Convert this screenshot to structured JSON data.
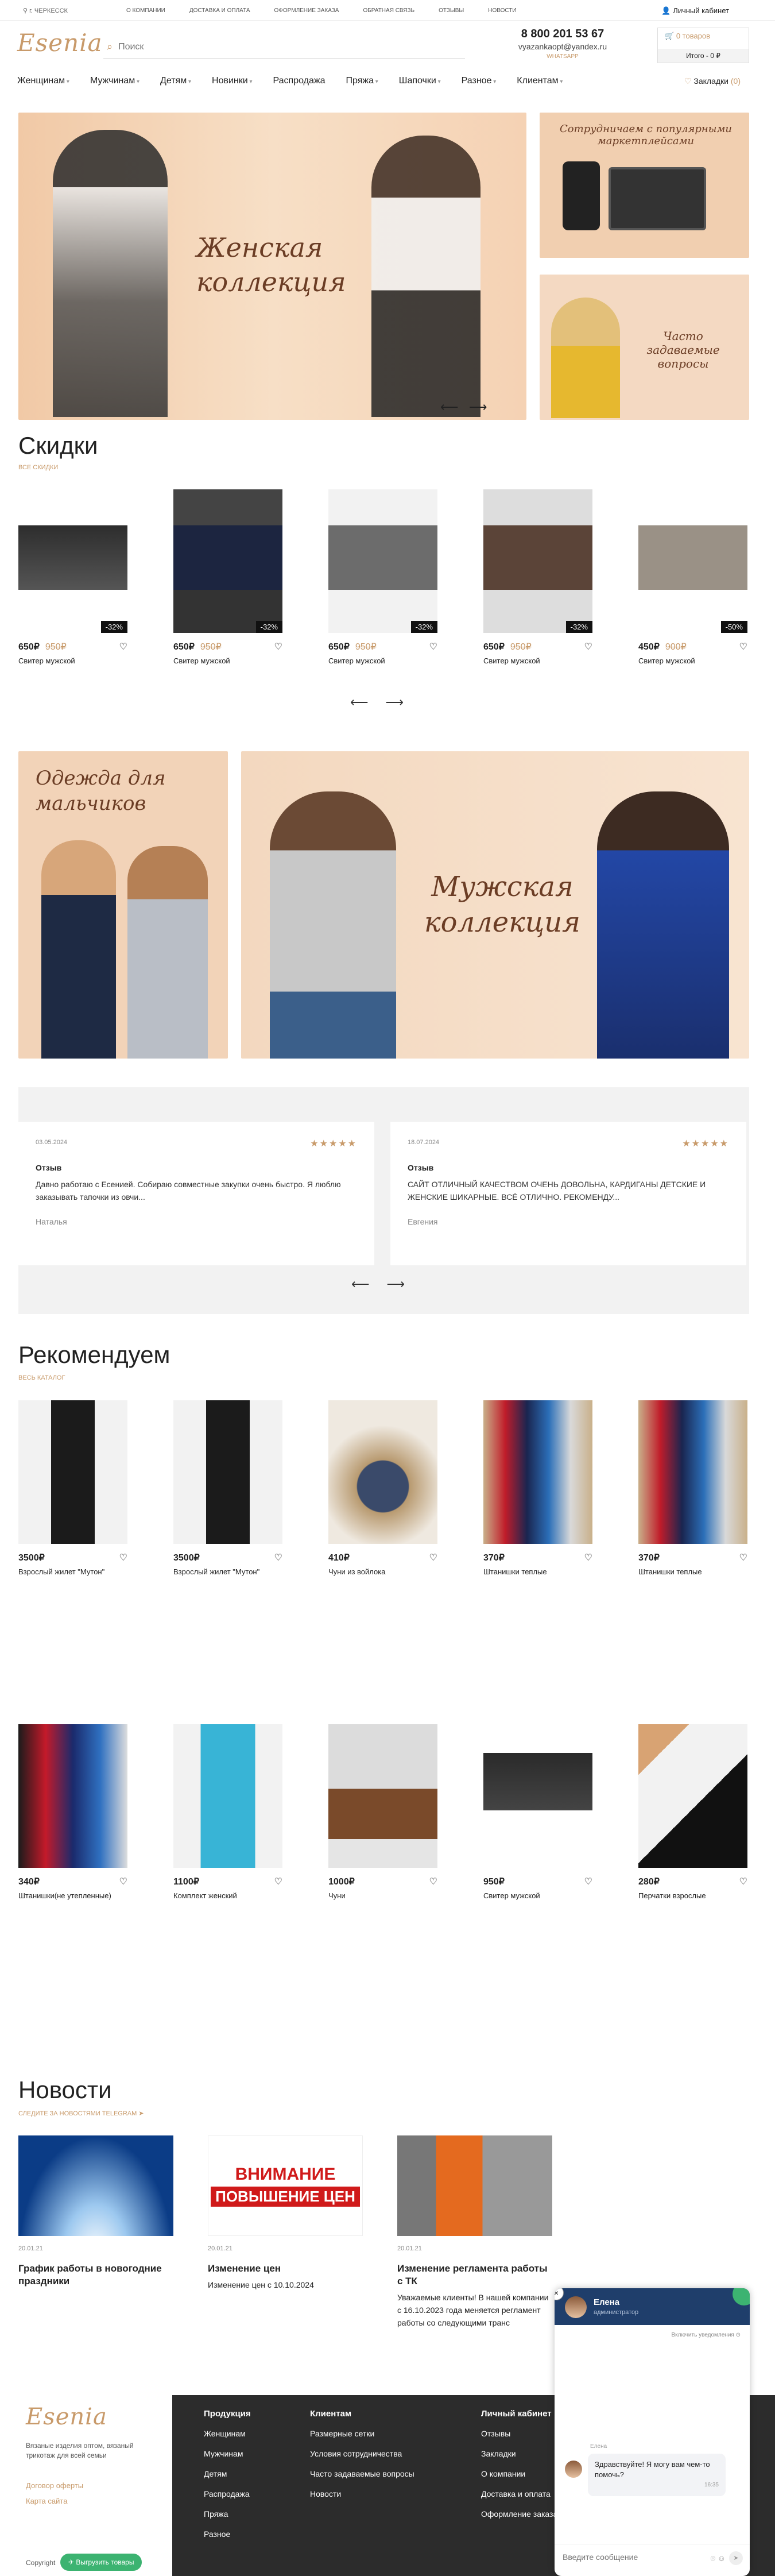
{
  "topbar": {
    "city": "г. ЧЕРКЕССК",
    "links": [
      "О КОМПАНИИ",
      "ДОСТАВКА И ОПЛАТА",
      "ОФОРМЛЕНИЕ ЗАКАЗА",
      "ОБРАТНАЯ СВЯЗЬ",
      "ОТЗЫВЫ",
      "НОВОСТИ"
    ],
    "account": "Личный кабинет"
  },
  "header": {
    "logo": "Esenia",
    "search_placeholder": "Поиск",
    "phone": "8 800 201 53 67",
    "email": "vyazankaopt@yandex.ru",
    "whatsapp": "WHATSAPP",
    "cart_count": "0 товаров",
    "cart_total": "Итого - 0 ₽"
  },
  "nav": {
    "items": [
      "Женщинам",
      "Мужчинам",
      "Детям",
      "Новинки",
      "Распродажа",
      "Пряжа",
      "Шапочки",
      "Разное",
      "Клиентам"
    ],
    "favorites": "Закладки",
    "favorites_count": "(0)"
  },
  "banners": {
    "women": "Женская коллекция",
    "marketplaces": "Сотрудничаем с популярными маркетплейсами",
    "faq": "Часто задаваемые вопросы",
    "boys": "Одежда для мальчиков",
    "men": "Мужская коллекция"
  },
  "sale": {
    "title": "Скидки",
    "subtitle": "ВСЕ СКИДКИ",
    "products": [
      {
        "price": "650₽",
        "old": "950₽",
        "discount": "-32%",
        "name": "Свитер мужской"
      },
      {
        "price": "650₽",
        "old": "950₽",
        "discount": "-32%",
        "name": "Свитер мужской"
      },
      {
        "price": "650₽",
        "old": "950₽",
        "discount": "-32%",
        "name": "Свитер мужской"
      },
      {
        "price": "650₽",
        "old": "950₽",
        "discount": "-32%",
        "name": "Свитер мужской"
      },
      {
        "price": "450₽",
        "old": "900₽",
        "discount": "-50%",
        "name": "Свитер мужской"
      }
    ]
  },
  "reviews": [
    {
      "date": "03.05.2024",
      "title": "Отзыв",
      "text": "Давно работаю с Есенией. Собираю совместные закупки очень быстро. Я люблю заказывать тапочки из овчи...",
      "author": "Наталья"
    },
    {
      "date": "18.07.2024",
      "title": "Отзыв",
      "text": "САЙТ ОТЛИЧНЫЙ КАЧЕСТВОМ ОЧЕНЬ ДОВОЛЬНА, КАРДИГАНЫ ДЕТСКИЕ И ЖЕНСКИЕ ШИКАРНЫЕ. ВСЁ ОТЛИЧНО. РЕКОМЕНДУ...",
      "author": "Евгения"
    }
  ],
  "recommend": {
    "title": "Рекомендуем",
    "subtitle": "ВЕСЬ КАТАЛОГ",
    "row1": [
      {
        "price": "3500₽",
        "name": "Взрослый жилет \"Мутон\""
      },
      {
        "price": "3500₽",
        "name": "Взрослый жилет \"Мутон\""
      },
      {
        "price": "410₽",
        "name": "Чуни из войлока"
      },
      {
        "price": "370₽",
        "name": "Штанишки теплые"
      },
      {
        "price": "370₽",
        "name": "Штанишки теплые"
      }
    ],
    "row2": [
      {
        "price": "340₽",
        "name": "Штанишки(не утепленные)"
      },
      {
        "price": "1100₽",
        "name": "Комплект женский"
      },
      {
        "price": "1000₽",
        "name": "Чуни"
      },
      {
        "price": "950₽",
        "name": "Свитер мужской"
      },
      {
        "price": "280₽",
        "name": "Перчатки взрослые"
      }
    ]
  },
  "news": {
    "title": "Новости",
    "subtitle": "СЛЕДИТЕ ЗА НОВОСТЯМИ TELEGRAM",
    "items": [
      {
        "date": "20.01.21",
        "title": "График работы в новогодние праздники",
        "text": ""
      },
      {
        "date": "20.01.21",
        "title": "Изменение цен",
        "text": "Изменение цен с 10.10.2024",
        "img1": "ВНИМАНИЕ",
        "img2": "ПОВЫШЕНИЕ ЦЕН"
      },
      {
        "date": "20.01.21",
        "title": "Изменение регламента работы с ТК",
        "text": "Уважаемые клиенты! В нашей компании с 16.10.2023 года меняется регламент работы со следующими транс"
      }
    ]
  },
  "footer": {
    "logo": "Esenia",
    "desc": "Вязаные изделия оптом, вязаный трикотаж для всей семьи",
    "links": [
      "Договор оферты",
      "Карта сайта"
    ],
    "copy": "Copyright",
    "tg_button": "Выгрузить товары",
    "cols": [
      {
        "head": "Продукция",
        "items": [
          "Женщинам",
          "Мужчинам",
          "Детям",
          "Распродажа",
          "Пряжа",
          "Разное"
        ]
      },
      {
        "head": "Клиентам",
        "items": [
          "Размерные сетки",
          "Условия сотрудничества",
          "Часто задаваемые вопросы",
          "Новости"
        ]
      },
      {
        "head": "Личный кабинет",
        "items": [
          "Отзывы",
          "Закладки",
          "О компании",
          "Доставка и оплата",
          "Оформление заказа"
        ]
      }
    ]
  },
  "chat": {
    "name": "Елена",
    "role": "администратор",
    "status": "Включить уведомления",
    "msg_author": "Елена",
    "message": "Здравствуйте! Я могу вам чем-то помочь?",
    "time": "16:35",
    "input_placeholder": "Введите сообщение"
  }
}
